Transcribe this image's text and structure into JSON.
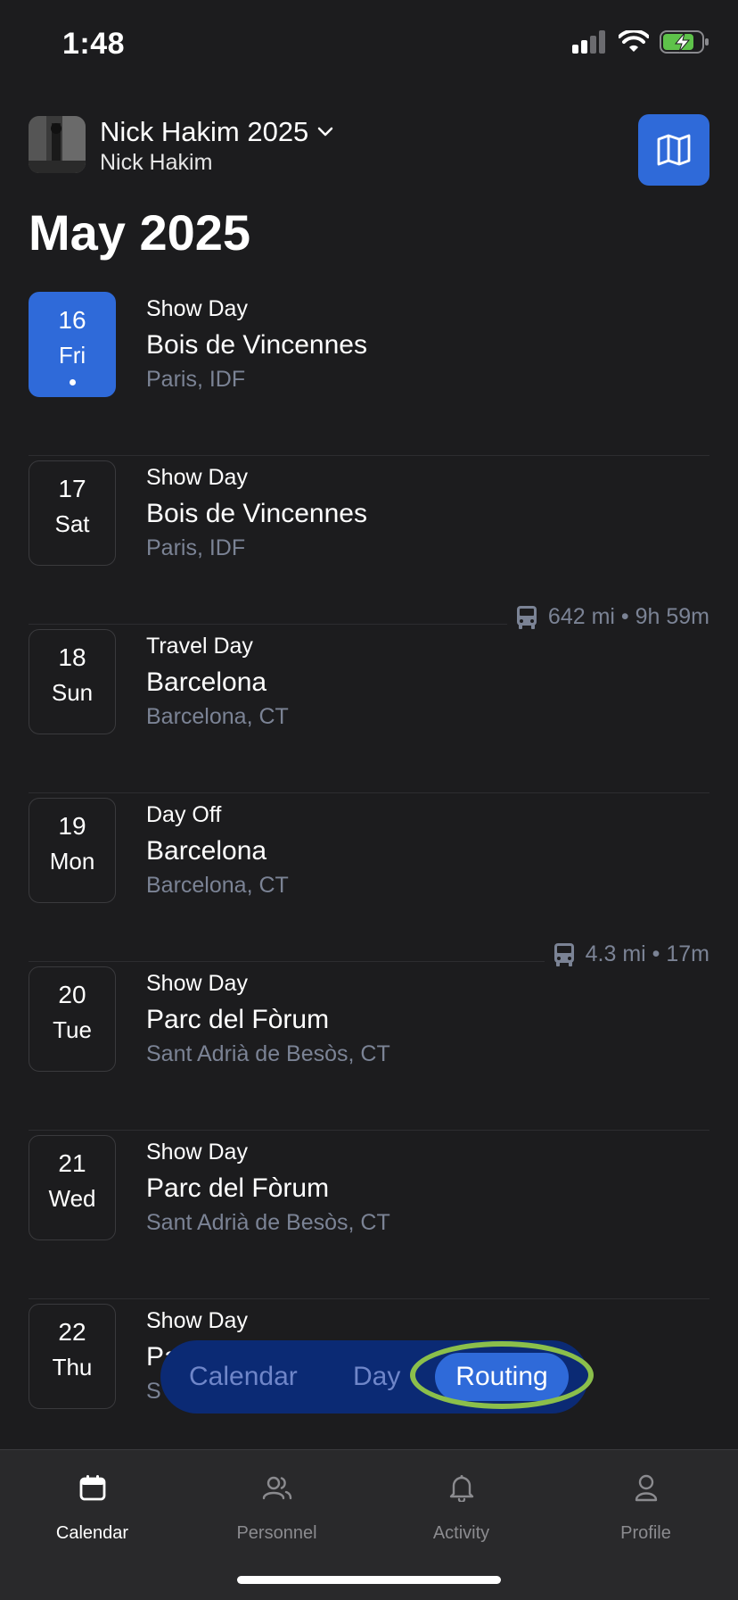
{
  "status": {
    "time": "1:48"
  },
  "header": {
    "title": "Nick Hakim 2025",
    "subtitle": "Nick Hakim"
  },
  "month": "May 2025",
  "days": [
    {
      "num": "16",
      "dow": "Fri",
      "type": "Show Day",
      "venue": "Bois de Vincennes",
      "loc": "Paris, IDF",
      "active": true
    },
    {
      "num": "17",
      "dow": "Sat",
      "type": "Show Day",
      "venue": "Bois de Vincennes",
      "loc": "Paris, IDF",
      "travel": "642 mi • 9h 59m"
    },
    {
      "num": "18",
      "dow": "Sun",
      "type": "Travel Day",
      "venue": "Barcelona",
      "loc": "Barcelona, CT"
    },
    {
      "num": "19",
      "dow": "Mon",
      "type": "Day Off",
      "venue": "Barcelona",
      "loc": "Barcelona, CT",
      "travel": "4.3 mi • 17m"
    },
    {
      "num": "20",
      "dow": "Tue",
      "type": "Show Day",
      "venue": "Parc del Fòrum",
      "loc": "Sant Adrià de Besòs, CT"
    },
    {
      "num": "21",
      "dow": "Wed",
      "type": "Show Day",
      "venue": "Parc del Fòrum",
      "loc": "Sant Adrià de Besòs, CT"
    },
    {
      "num": "22",
      "dow": "Thu",
      "type": "Show Day",
      "venue": "Pa",
      "loc": "S"
    }
  ],
  "segment": {
    "calendar": "Calendar",
    "day": "Day",
    "routing": "Routing",
    "selected": "Routing"
  },
  "tabs": [
    {
      "label": "Calendar",
      "icon": "calendar-icon"
    },
    {
      "label": "Personnel",
      "icon": "people-icon"
    },
    {
      "label": "Activity",
      "icon": "bell-icon"
    },
    {
      "label": "Profile",
      "icon": "person-icon"
    }
  ],
  "colors": {
    "accent": "#2f6ad9",
    "highlight": "#8bbf4b",
    "background": "#1c1c1e"
  }
}
